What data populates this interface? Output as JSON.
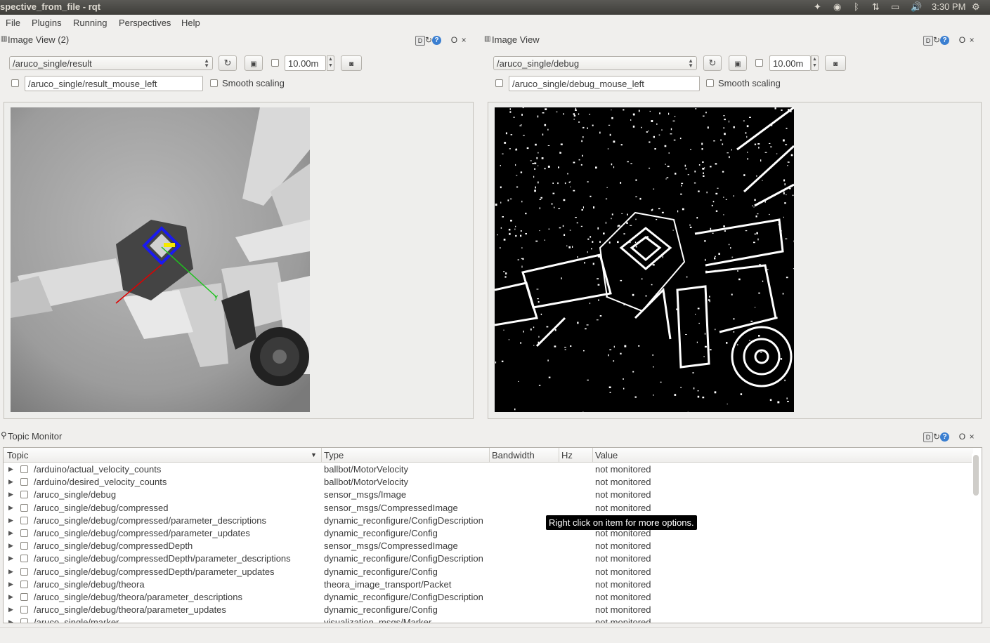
{
  "window": {
    "title": "spective_from_file - rqt",
    "clock": "3:30 PM"
  },
  "menubar": {
    "items": [
      "File",
      "Plugins",
      "Running",
      "Perspectives",
      "Help"
    ]
  },
  "left_view": {
    "title": "Image View (2)",
    "topic": "/aruco_single/result",
    "rate": "10.00m",
    "mouse_topic": "/aruco_single/result_mouse_left",
    "smooth_label": "Smooth scaling"
  },
  "right_view": {
    "title": "Image View",
    "topic": "/aruco_single/debug",
    "rate": "10.00m",
    "mouse_topic": "/aruco_single/debug_mouse_left",
    "smooth_label": "Smooth scaling"
  },
  "dock_buttons": {
    "d": "D",
    "q": "?",
    "float": "O",
    "close": "×"
  },
  "topic_monitor": {
    "title": "Topic Monitor",
    "columns": [
      "Topic",
      "Type",
      "Bandwidth",
      "Hz",
      "Value"
    ],
    "rows": [
      {
        "topic": "/arduino/actual_velocity_counts",
        "type": "ballbot/MotorVelocity",
        "value": "not monitored"
      },
      {
        "topic": "/arduino/desired_velocity_counts",
        "type": "ballbot/MotorVelocity",
        "value": "not monitored"
      },
      {
        "topic": "/aruco_single/debug",
        "type": "sensor_msgs/Image",
        "value": "not monitored"
      },
      {
        "topic": "/aruco_single/debug/compressed",
        "type": "sensor_msgs/CompressedImage",
        "value": "not monitored"
      },
      {
        "topic": "/aruco_single/debug/compressed/parameter_descriptions",
        "type": "dynamic_reconfigure/ConfigDescription",
        "value": ""
      },
      {
        "topic": "/aruco_single/debug/compressed/parameter_updates",
        "type": "dynamic_reconfigure/Config",
        "value": "not monitored"
      },
      {
        "topic": "/aruco_single/debug/compressedDepth",
        "type": "sensor_msgs/CompressedImage",
        "value": "not monitored"
      },
      {
        "topic": "/aruco_single/debug/compressedDepth/parameter_descriptions",
        "type": "dynamic_reconfigure/ConfigDescription",
        "value": "not monitored"
      },
      {
        "topic": "/aruco_single/debug/compressedDepth/parameter_updates",
        "type": "dynamic_reconfigure/Config",
        "value": "not monitored"
      },
      {
        "topic": "/aruco_single/debug/theora",
        "type": "theora_image_transport/Packet",
        "value": "not monitored"
      },
      {
        "topic": "/aruco_single/debug/theora/parameter_descriptions",
        "type": "dynamic_reconfigure/ConfigDescription",
        "value": "not monitored"
      },
      {
        "topic": "/aruco_single/debug/theora/parameter_updates",
        "type": "dynamic_reconfigure/Config",
        "value": "not monitored"
      },
      {
        "topic": "/aruco_single/marker",
        "type": "visualization_msgs/Marker",
        "value": "not monitored"
      }
    ],
    "tooltip": "Right click on item for more options."
  },
  "icons": [
    "refresh-icon",
    "save-icon",
    "camera-icon",
    "search-icon",
    "settings-icon",
    "volume-icon",
    "bluetooth-icon"
  ],
  "colors": {
    "titlebar": "#3e3d39",
    "tooltip_bg": "#000000",
    "help_blue": "#3b7fd1"
  }
}
